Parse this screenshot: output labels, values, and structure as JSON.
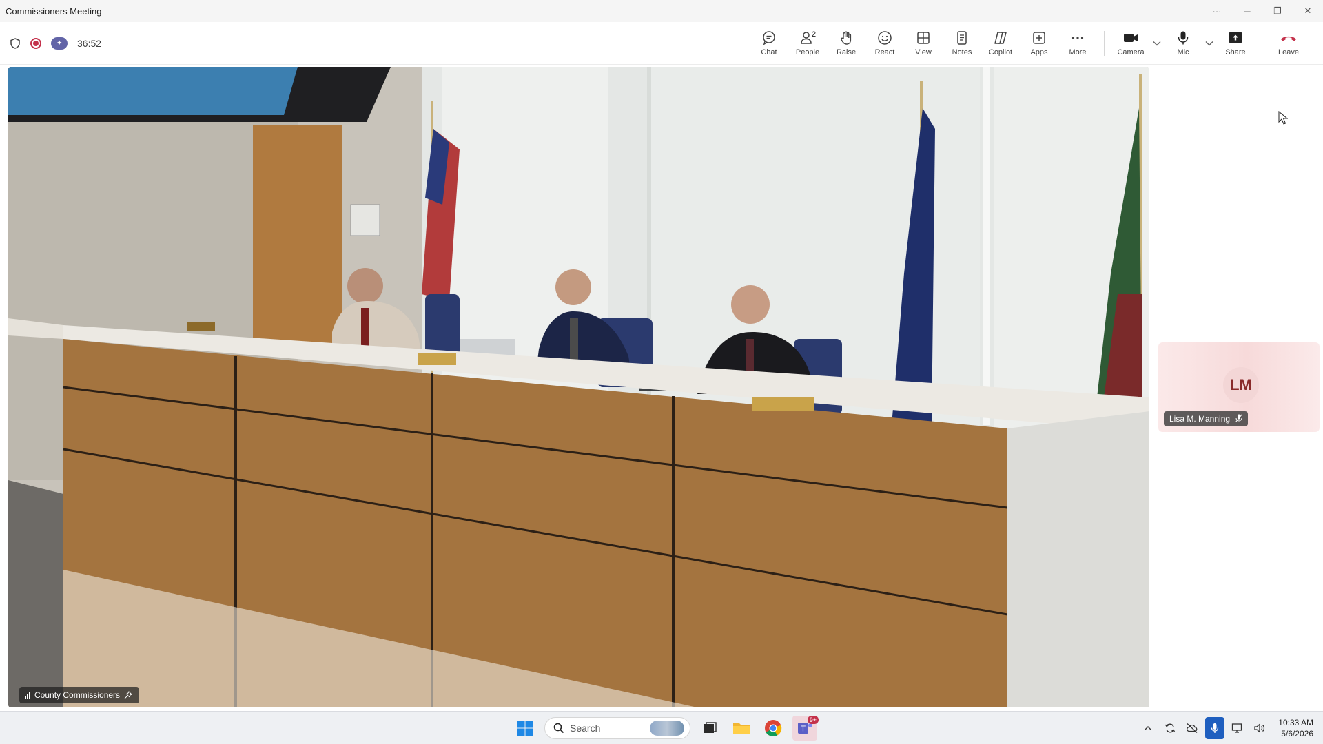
{
  "window": {
    "title": "Commissioners Meeting",
    "controls": [
      "···",
      "─",
      "❐",
      "✕"
    ]
  },
  "meeting": {
    "timer": "36:52",
    "toolbar": [
      {
        "key": "chat",
        "label": "Chat",
        "icon": "chat-icon"
      },
      {
        "key": "people",
        "label": "People",
        "icon": "people-icon",
        "count": "2"
      },
      {
        "key": "raise",
        "label": "Raise",
        "icon": "raise-hand-icon"
      },
      {
        "key": "react",
        "label": "React",
        "icon": "react-icon"
      },
      {
        "key": "view",
        "label": "View",
        "icon": "view-icon"
      },
      {
        "key": "notes",
        "label": "Notes",
        "icon": "notes-icon"
      },
      {
        "key": "copilot",
        "label": "Copilot",
        "icon": "copilot-icon"
      },
      {
        "key": "apps",
        "label": "Apps",
        "icon": "apps-icon"
      },
      {
        "key": "more",
        "label": "More",
        "icon": "more-icon"
      }
    ],
    "camera_label": "Camera",
    "mic_label": "Mic",
    "share_label": "Share",
    "leave_label": "Leave",
    "leave_color": "#c4314b",
    "accent_color": "#6264a7"
  },
  "stage": {
    "label": "County Commissioners",
    "feed": "video-feed of a meeting room with three men seated at a wooden dais with flags behind them"
  },
  "participants": [
    {
      "initials": "LM",
      "name": "Lisa M. Manning",
      "muted": true
    }
  ],
  "taskbar": {
    "search_placeholder": "Search",
    "teams_badge": "9+",
    "time": "10:33 AM",
    "date": "5/6/2026"
  }
}
